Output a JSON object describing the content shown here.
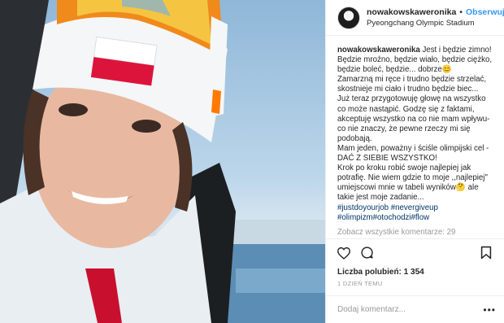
{
  "header": {
    "username": "nowakowskaweronika",
    "separator": "•",
    "follow_label": "Obserwuj",
    "location": "Pyeongchang Olympic Stadium"
  },
  "caption": {
    "username": "nowakowskaweronika",
    "text": " Jest i będzie zimno!\nBędzie mroźno, będzie wiało, będzie ciężko, będzie boleć, będzie... dobrze😊\nZamarzną mi ręce i trudno będzie strzelać, skostnieje mi ciało i trudno będzie biec... Już teraz przygotowuję głowę na wszystko co może nastąpić. Godzę się z faktami, akceptuję wszystko na co nie mam wpływu-co nie znaczy, że pewne rzeczy mi się podobają.\nMam jeden, poważny i ściśle olimpijski cel -DAĆ Z SIEBIE WSZYSTKO!\nKrok po kroku robić swoje najlepiej jak potrafię. Nie wiem gdzie to moje ,,najlepiej\" umiejscowi mnie w tabeli wyników🤔 ale takie jest moje zadanie...",
    "hashtags": "#justdoyourjob #nevergiveup #olimpizm#otochodzi#flow",
    "view_all_comments": "Zobacz wszystkie komentarze: 29"
  },
  "likes": "Liczba polubień: 1 354",
  "date": "1 DZIEŃ TEMU",
  "comment": {
    "placeholder": "Dodaj komentarz...",
    "more_label": "•••"
  },
  "icons": {
    "like": "heart-icon",
    "comment": "comment-bubble-icon",
    "save": "bookmark-icon"
  },
  "colors": {
    "follow": "#3897f0",
    "hashtag": "#003569",
    "muted": "#999999"
  }
}
